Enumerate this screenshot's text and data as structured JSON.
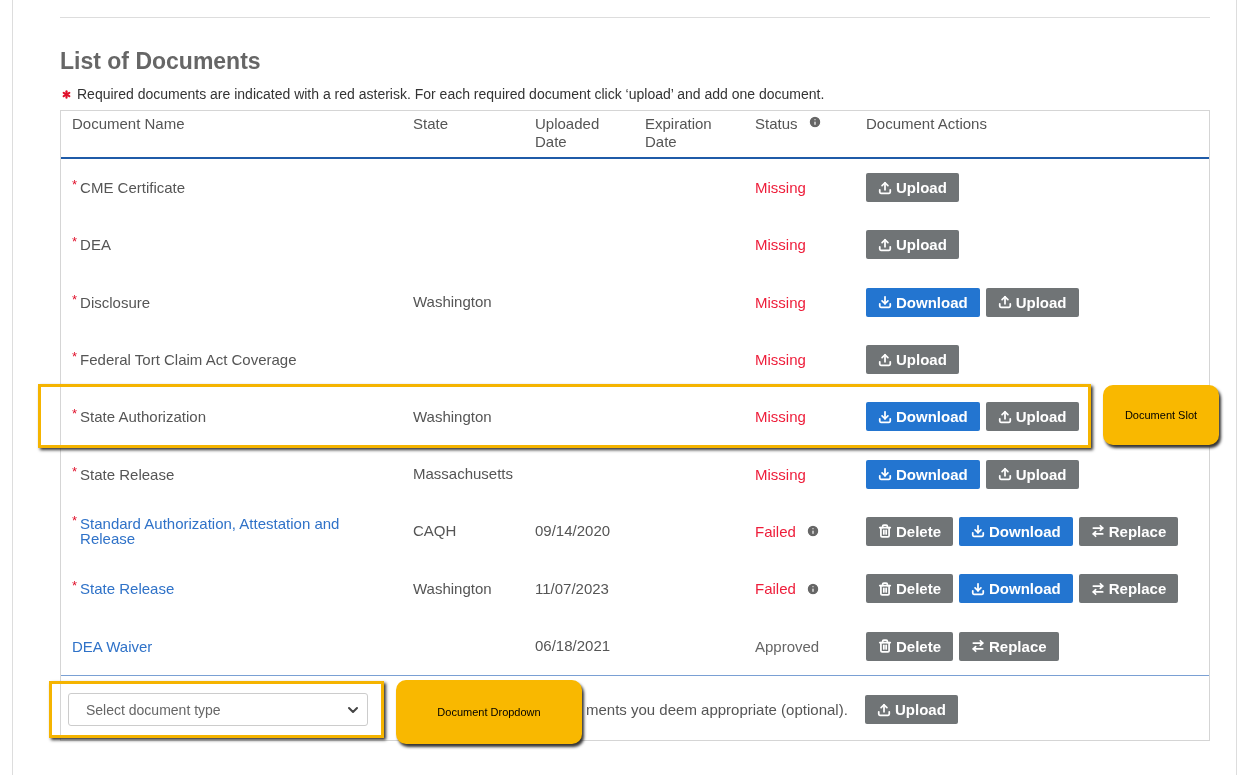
{
  "title": "List of Documents",
  "note": "Required documents are indicated with a red asterisk. For each required document click ‘upload’ and add one document.",
  "table": {
    "columns": [
      {
        "label": "Document Name",
        "info": false
      },
      {
        "label": "State",
        "info": false
      },
      {
        "label": "Uploaded Date",
        "info": false
      },
      {
        "label": "Expiration Date",
        "info": false
      },
      {
        "label": "Status",
        "info": true
      },
      {
        "label": "Document Actions",
        "info": false
      }
    ],
    "rows": [
      {
        "marker": "*",
        "name": "CME Certificate",
        "link": false,
        "status": "Missing",
        "color": "#ee1d3a",
        "status_info": false,
        "highlighted": false,
        "actions": [
          {
            "kind": "upload",
            "label": "Upload"
          }
        ]
      },
      {
        "marker": "*",
        "name": "DEA",
        "link": false,
        "status": "Missing",
        "color": "#ee1d3a",
        "status_info": false,
        "highlighted": false,
        "actions": [
          {
            "kind": "upload",
            "label": "Upload"
          }
        ]
      },
      {
        "marker": "*",
        "name": "Disclosure",
        "link": false,
        "state": "Washington",
        "status": "Missing",
        "color": "#ee1d3a",
        "status_info": false,
        "highlighted": false,
        "actions": [
          {
            "kind": "download",
            "label": "Download"
          },
          {
            "kind": "upload",
            "label": "Upload"
          }
        ]
      },
      {
        "marker": "*",
        "name": "Federal Tort Claim Act Coverage",
        "link": false,
        "status": "Missing",
        "color": "#ee1d3a",
        "status_info": false,
        "highlighted": false,
        "actions": [
          {
            "kind": "upload",
            "label": "Upload"
          }
        ]
      },
      {
        "marker": "*",
        "name": "State Authorization",
        "link": false,
        "state": "Washington",
        "status": "Missing",
        "color": "#ee1d3a",
        "status_info": false,
        "highlighted": true,
        "callout": "Document Slot",
        "actions": [
          {
            "kind": "download",
            "label": "Download"
          },
          {
            "kind": "upload",
            "label": "Upload"
          }
        ]
      },
      {
        "marker": "*",
        "name": "State Release",
        "link": false,
        "state": "Massachusetts",
        "status": "Missing",
        "color": "#ee1d3a",
        "status_info": false,
        "highlighted": false,
        "actions": [
          {
            "kind": "download",
            "label": "Download"
          },
          {
            "kind": "upload",
            "label": "Upload"
          }
        ]
      },
      {
        "marker": "*",
        "name": "Standard Authorization, Attestation and Release",
        "link": true,
        "state": "CAQH",
        "uploaded": "09/14/2020",
        "status": "Failed",
        "color": "#ee1d3a",
        "status_info": true,
        "highlighted": false,
        "actions": [
          {
            "kind": "delete",
            "label": "Delete"
          },
          {
            "kind": "download",
            "label": "Download"
          },
          {
            "kind": "replace",
            "label": "Replace"
          }
        ]
      },
      {
        "marker": "*",
        "name": "State Release",
        "link": true,
        "state": "Washington",
        "uploaded": "11/07/2023",
        "status": "Failed",
        "color": "#ee1d3a",
        "status_info": true,
        "highlighted": false,
        "actions": [
          {
            "kind": "delete",
            "label": "Delete"
          },
          {
            "kind": "download",
            "label": "Download"
          },
          {
            "kind": "replace",
            "label": "Replace"
          }
        ]
      },
      {
        "name": "DEA Waiver",
        "link": true,
        "uploaded": "06/18/2021",
        "status": "Approved",
        "color": "#666666",
        "status_info": false,
        "highlighted": false,
        "actions": [
          {
            "kind": "delete",
            "label": "Delete"
          },
          {
            "kind": "replace",
            "label": "Replace"
          }
        ]
      }
    ]
  },
  "footer": {
    "select": {
      "placeholder": "Select document type",
      "highlighted": true,
      "callout": "Document Dropdown"
    },
    "text": "ments you deem appropriate (optional).",
    "action": {
      "kind": "upload",
      "label": "Upload"
    }
  }
}
